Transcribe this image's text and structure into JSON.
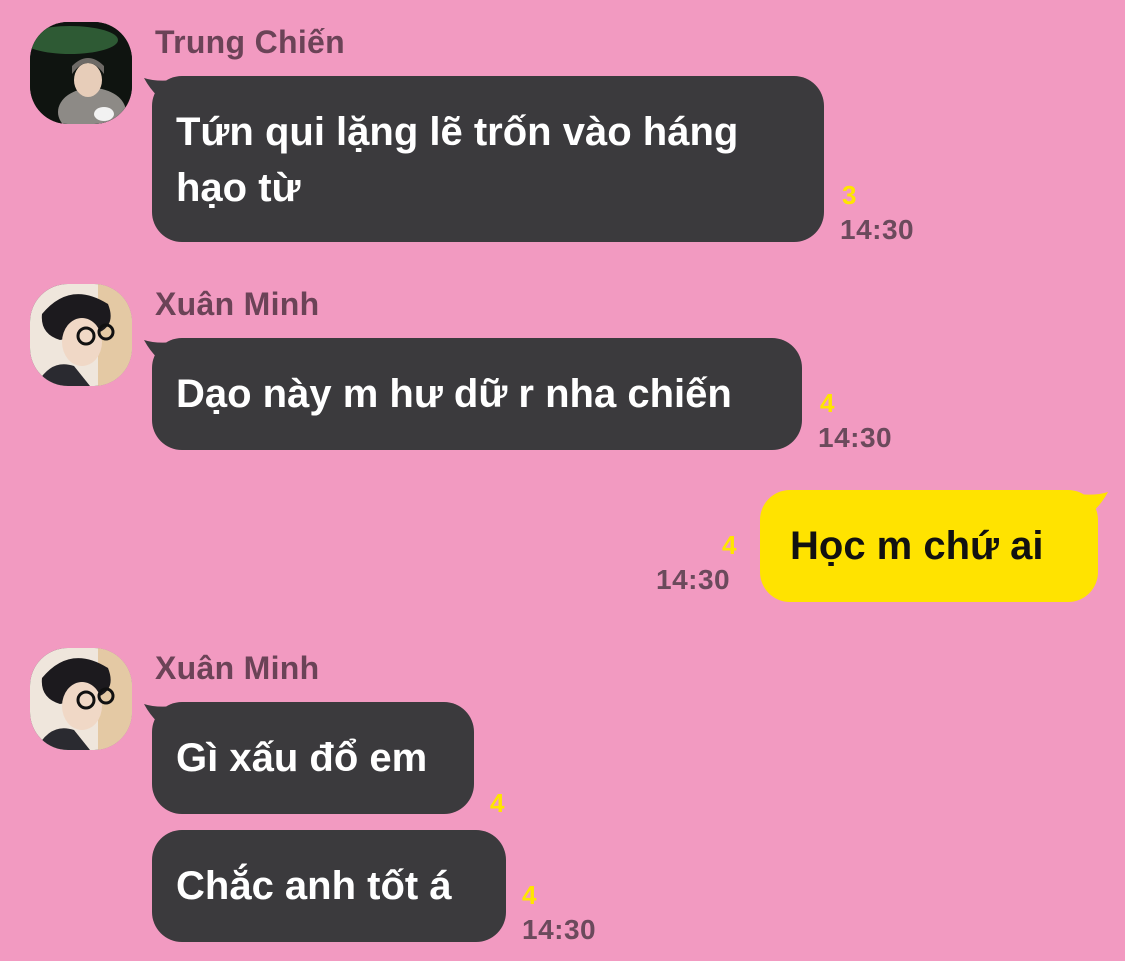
{
  "colors": {
    "background": "#f29ac1",
    "incoming_bubble": "#3b3a3d",
    "outgoing_bubble": "#ffe300",
    "unread_count": "#ffe500",
    "timestamp": "#6b4a5c"
  },
  "messages": [
    {
      "sender": "Trung Chiến",
      "text": "Tứn qui lặng lẽ trốn vào háng\nhạo từ",
      "unread": "3",
      "time": "14:30"
    },
    {
      "sender": "Xuân Minh",
      "text": "Dạo này m hư dữ r nha chiến",
      "unread": "4",
      "time": "14:30"
    },
    {
      "text": "Học m chứ ai",
      "unread": "4",
      "time": "14:30"
    },
    {
      "sender": "Xuân Minh",
      "text": "Gì xấu đổ em",
      "unread": "4"
    },
    {
      "text": "Chắc anh tốt á",
      "unread": "4",
      "time": "14:30"
    }
  ]
}
